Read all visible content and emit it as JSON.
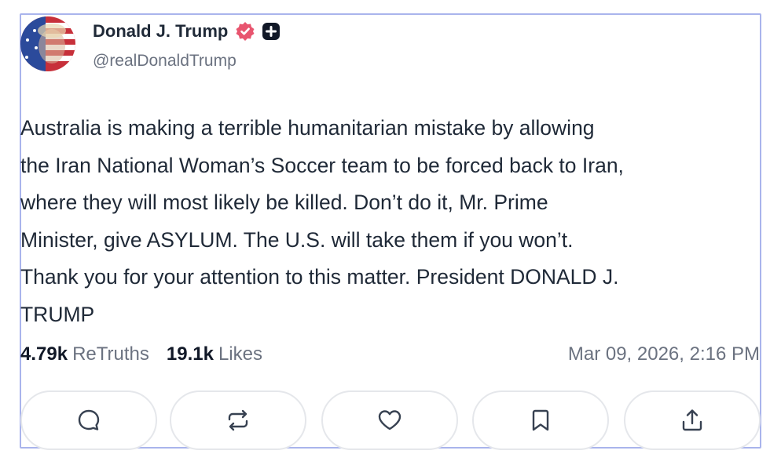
{
  "post": {
    "author_name": "Donald J. Trump",
    "handle": "@realDonaldTrump",
    "body": "Australia is making a terrible humanitarian mistake by allowing\nthe Iran National Woman’s Soccer team to be forced back to Iran,\nwhere they will most likely be killed. Don’t do it, Mr. Prime\nMinister, give ASYLUM. The U.S. will take them if you won’t.\nThank you for your attention to this matter. President DONALD J.\nTRUMP",
    "retruths_count": "4.79k",
    "retruths_label": "ReTruths",
    "likes_count": "19.1k",
    "likes_label": "Likes",
    "timestamp": "Mar 09, 2026, 2:16 PM"
  },
  "icons": {
    "verified": "verified-badge-icon",
    "plus": "plus-badge-icon",
    "reply": "reply-icon",
    "retruth": "retruth-icon",
    "like": "heart-icon",
    "bookmark": "bookmark-icon",
    "share": "share-icon"
  },
  "colors": {
    "border": "#a9b4ec",
    "verified_badge": "#e8556f",
    "muted_text": "#6b7280"
  }
}
